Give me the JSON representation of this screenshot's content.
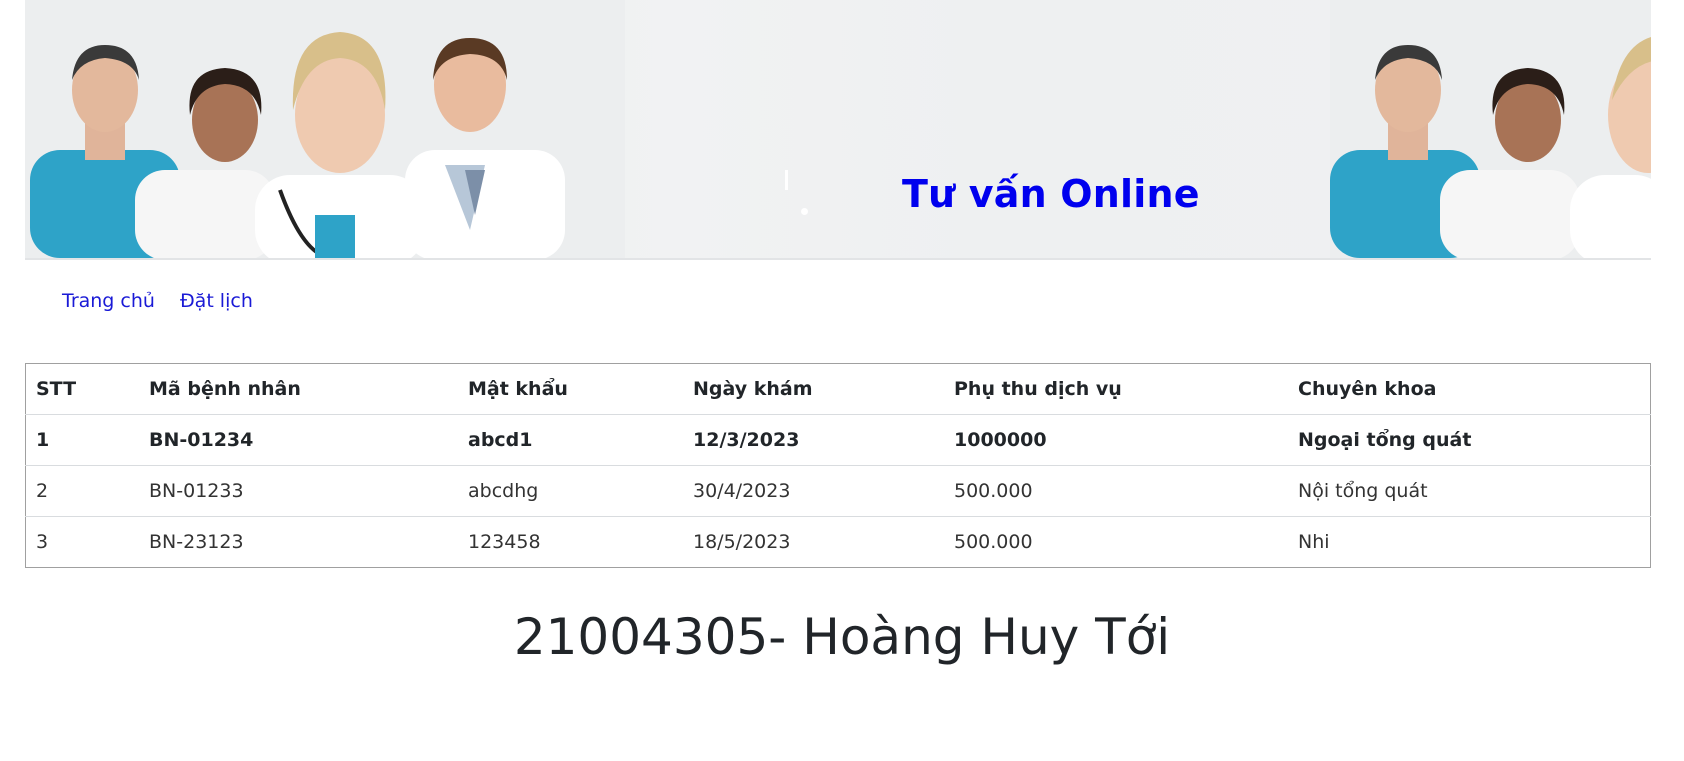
{
  "banner": {
    "title": "Tư vấn Online",
    "title_color": "#0000ee"
  },
  "nav": {
    "items": [
      {
        "label": "Trang chủ"
      },
      {
        "label": "Đặt lịch"
      }
    ],
    "link_color": "#1a1ad6"
  },
  "table": {
    "headers": [
      "STT",
      "Mã bệnh nhân",
      "Mật khẩu",
      "Ngày khám",
      "Phụ thu dịch vụ",
      "Chuyên khoa"
    ],
    "rows": [
      [
        "1",
        "BN-01234",
        "abcd1",
        "12/3/2023",
        "1000000",
        "Ngoại tổng quát"
      ],
      [
        "2",
        "BN-01233",
        "abcdhg",
        "30/4/2023",
        "500.000",
        "Nội tổng quát"
      ],
      [
        "3",
        "BN-23123",
        "123458",
        "18/5/2023",
        "500.000",
        "Nhi"
      ]
    ]
  },
  "footer": {
    "student": "21004305- Hoàng Huy Tới"
  }
}
